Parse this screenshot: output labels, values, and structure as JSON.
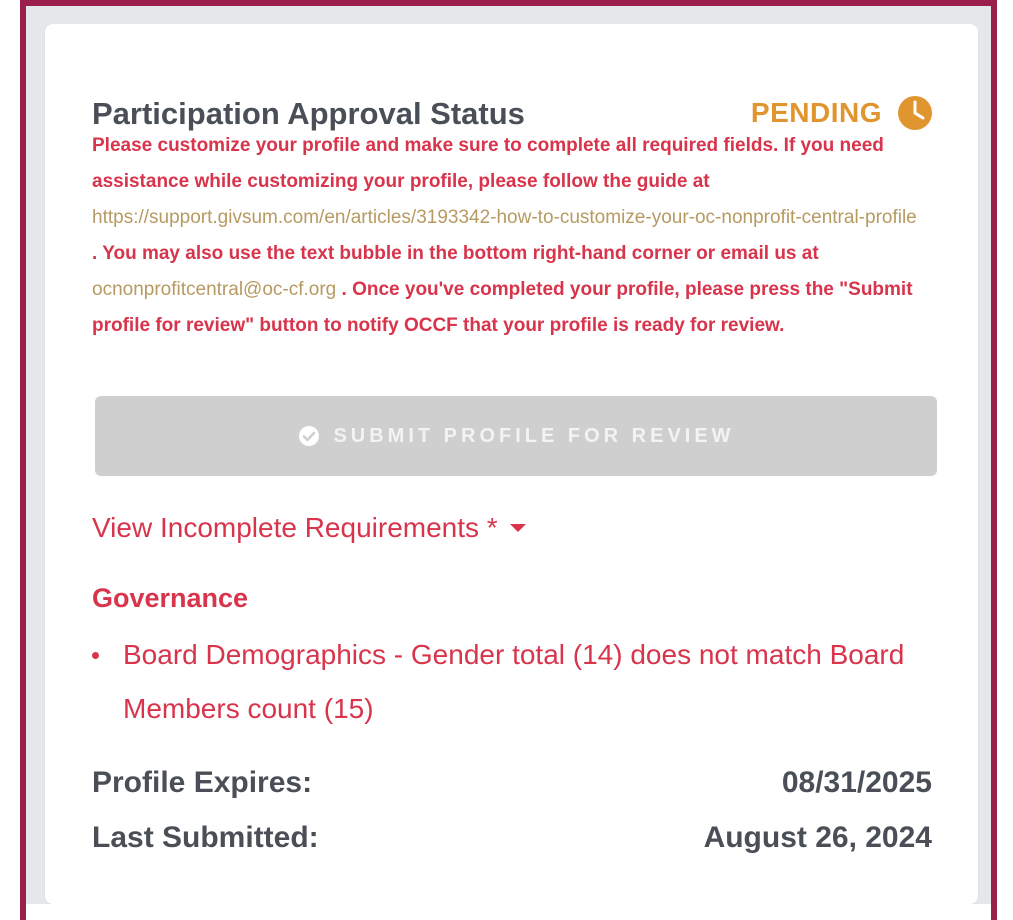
{
  "panel": {
    "title": "Participation Approval Status",
    "status": "PENDING",
    "icons": {
      "status": "clock-icon",
      "submit": "check-circle-icon",
      "toggle": "caret-down-icon"
    },
    "message": {
      "part1": "Please customize your profile and make sure to complete all required fields. If you need assistance while customizing your profile, please follow the guide at ",
      "link1": "https://support.givsum.com/en/articles/3193342-how-to-customize-your-oc-nonprofit-central-profile",
      "part2": " . You may also use the text bubble in the bottom right-hand corner or email us at ",
      "link2": "ocnonprofitcentral@oc-cf.org",
      "part3": " . Once you've completed your profile, please press the \"Submit profile for review\" button to notify OCCF that your profile is ready for review."
    },
    "submit_button_label": "SUBMIT PROFILE FOR REVIEW",
    "incomplete_toggle_label": "View Incomplete Requirements *",
    "requirements": {
      "section_title": "Governance",
      "items": [
        "Board Demographics - Gender total (14) does not match Board Members count (15)"
      ]
    },
    "meta": {
      "profile_expires_label": "Profile Expires:",
      "profile_expires_value": "08/31/2025",
      "last_submitted_label": "Last Submitted:",
      "last_submitted_value": "August 26, 2024"
    }
  },
  "colors": {
    "frame": "#9b1f4b",
    "alert_text": "#d8344c",
    "status_orange": "#e0952f",
    "link_tan": "#b79a61",
    "disabled_button": "#cfcfcf",
    "heading_gray": "#4a4f57"
  }
}
